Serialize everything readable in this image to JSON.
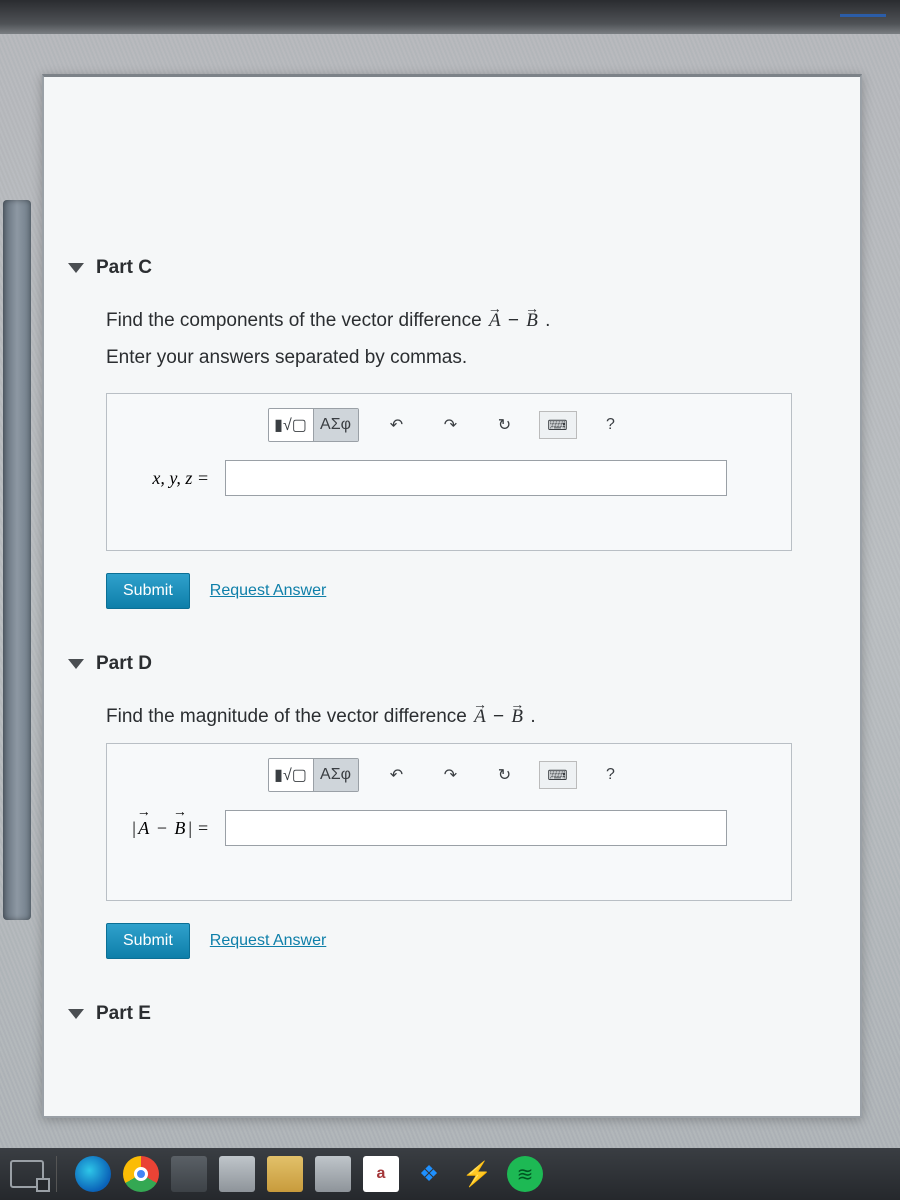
{
  "partC": {
    "title": "Part C",
    "question_prefix": "Find the components of the vector difference ",
    "vectorA": "A",
    "minus": " − ",
    "vectorB": "B",
    "period": ".",
    "instruction": "Enter your answers separated by commas.",
    "eq_label": "x, y, z =",
    "answer_value": "",
    "toolbar": {
      "templates_label": "▮√▢",
      "greek_label": "ΑΣφ",
      "undo_glyph": "↶",
      "redo_glyph": "↷",
      "reset_glyph": "↻",
      "keyboard_glyph": "⌨",
      "help_glyph": "?"
    },
    "submit_label": "Submit",
    "request_label": "Request Answer"
  },
  "partD": {
    "title": "Part D",
    "question_prefix": "Find the magnitude of the vector difference ",
    "vectorA": "A",
    "minus": " − ",
    "vectorB": "B",
    "period": ".",
    "eq_label": "|A − B| =",
    "answer_value": "",
    "toolbar": {
      "templates_label": "▮√▢",
      "greek_label": "ΑΣφ",
      "undo_glyph": "↶",
      "redo_glyph": "↷",
      "reset_glyph": "↻",
      "keyboard_glyph": "⌨",
      "help_glyph": "?"
    },
    "submit_label": "Submit",
    "request_label": "Request Answer"
  },
  "partE": {
    "title": "Part E"
  },
  "taskbar": {
    "items": [
      {
        "name": "task-view-icon"
      },
      {
        "name": "edge-icon"
      },
      {
        "name": "chrome-icon"
      },
      {
        "name": "store-icon"
      },
      {
        "name": "explorer-icon"
      },
      {
        "name": "folder-icon"
      },
      {
        "name": "app-icon"
      },
      {
        "name": "access-icon",
        "letter": "a"
      },
      {
        "name": "dropbox-icon",
        "glyph": "❖"
      },
      {
        "name": "winamp-icon",
        "glyph": "⚡"
      },
      {
        "name": "spotify-icon"
      }
    ]
  }
}
